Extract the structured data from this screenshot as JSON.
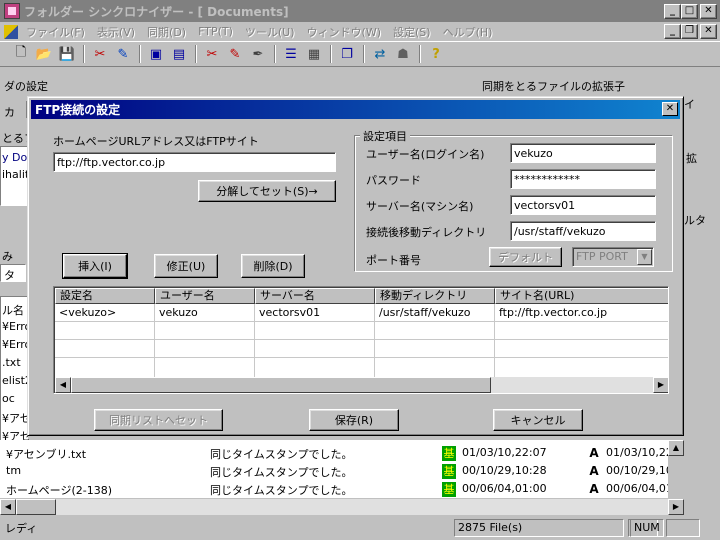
{
  "window": {
    "title": "フォルダー シンクロナイザー - [ Documents]"
  },
  "menu": [
    "ファイル(F)",
    "表示(V)",
    "同期(D)",
    "FTP(T)",
    "ツール(U)",
    "ウィンドウ(W)",
    "設定(S)",
    "ヘルプ(H)"
  ],
  "toolbar_icons": [
    "new-file-icon",
    "open-folder-icon",
    "save-icon",
    "sync-tool-icon",
    "edit-icon",
    "window-icon",
    "window-alt-icon",
    "sync-tool2-icon",
    "edit2-icon",
    "pen-icon",
    "list-icon",
    "panel-icon",
    "copy-icon",
    "ftp-connect-icon",
    "ftp-disconnect-icon",
    "help-icon"
  ],
  "background": {
    "folder_settings": "ダの設定",
    "ext_group": "同期をとるファイルの拡張子",
    "frag1": "カ",
    "frag2": "とるフォ",
    "frag3": "y Doc",
    "frag4": "ihalito",
    "frag5": "み",
    "frag6": "タ",
    "frag7": "ル名",
    "frag_right1": "イ",
    "frag_right2": "拡",
    "frag_right3": "ルタ",
    "frag_rows": [
      "¥Erro",
      "¥Erro",
      ".txt",
      "elist2",
      "oc",
      "¥アセ",
      "¥アセ"
    ],
    "rows": [
      {
        "name": "¥アセンブリ.txt",
        "status": "同じタイムスタンプでした。",
        "badge": "基",
        "date1": "01/03/10,22:07",
        "mark": "A",
        "date2": "01/03/10,22"
      },
      {
        "name": "tm",
        "status": "同じタイムスタンプでした。",
        "badge": "基",
        "date1": "00/10/29,10:28",
        "mark": "A",
        "date2": "00/10/29,10"
      },
      {
        "name": "ホームページ(2-138)",
        "status": "同じタイムスタンプでした。",
        "badge": "基",
        "date1": "00/06/04,01:00",
        "mark": "A",
        "date2": "00/06/04,01"
      }
    ]
  },
  "statusbar": {
    "ready": "レディ",
    "files": "2875 File(s)",
    "num": "NUM"
  },
  "dialog": {
    "title": "FTP接続の設定",
    "url_label": "ホームページURLアドレス又はFTPサイト",
    "url_value": "ftp://ftp.vector.co.jp",
    "decompose_button": "分解してセット(S)→",
    "settings_group": "設定項目",
    "user_label": "ユーザー名(ログイン名)",
    "user_value": "vekuzo",
    "password_label": "パスワード",
    "password_value": "************",
    "server_label": "サーバー名(マシン名)",
    "server_value": "vectorsv01",
    "dir_label": "接続後移動ディレクトリ",
    "dir_value": "/usr/staff/vekuzo",
    "port_label": "ポート番号",
    "default_button": "デフォルト",
    "port_select": "FTP PORT",
    "insert_button": "挿入(I)",
    "modify_button": "修正(U)",
    "delete_button": "削除(D)",
    "table": {
      "headers": [
        "設定名",
        "ユーザー名",
        "サーバー名",
        "移動ディレクトリ",
        "サイト名(URL)"
      ],
      "rows": [
        [
          "<vekuzo>",
          "vekuzo",
          "vectorsv01",
          "/usr/staff/vekuzo",
          "ftp://ftp.vector.co.jp"
        ]
      ]
    },
    "sync_list_button": "同期リストへセット",
    "save_button": "保存(R)",
    "cancel_button": "キャンセル"
  }
}
